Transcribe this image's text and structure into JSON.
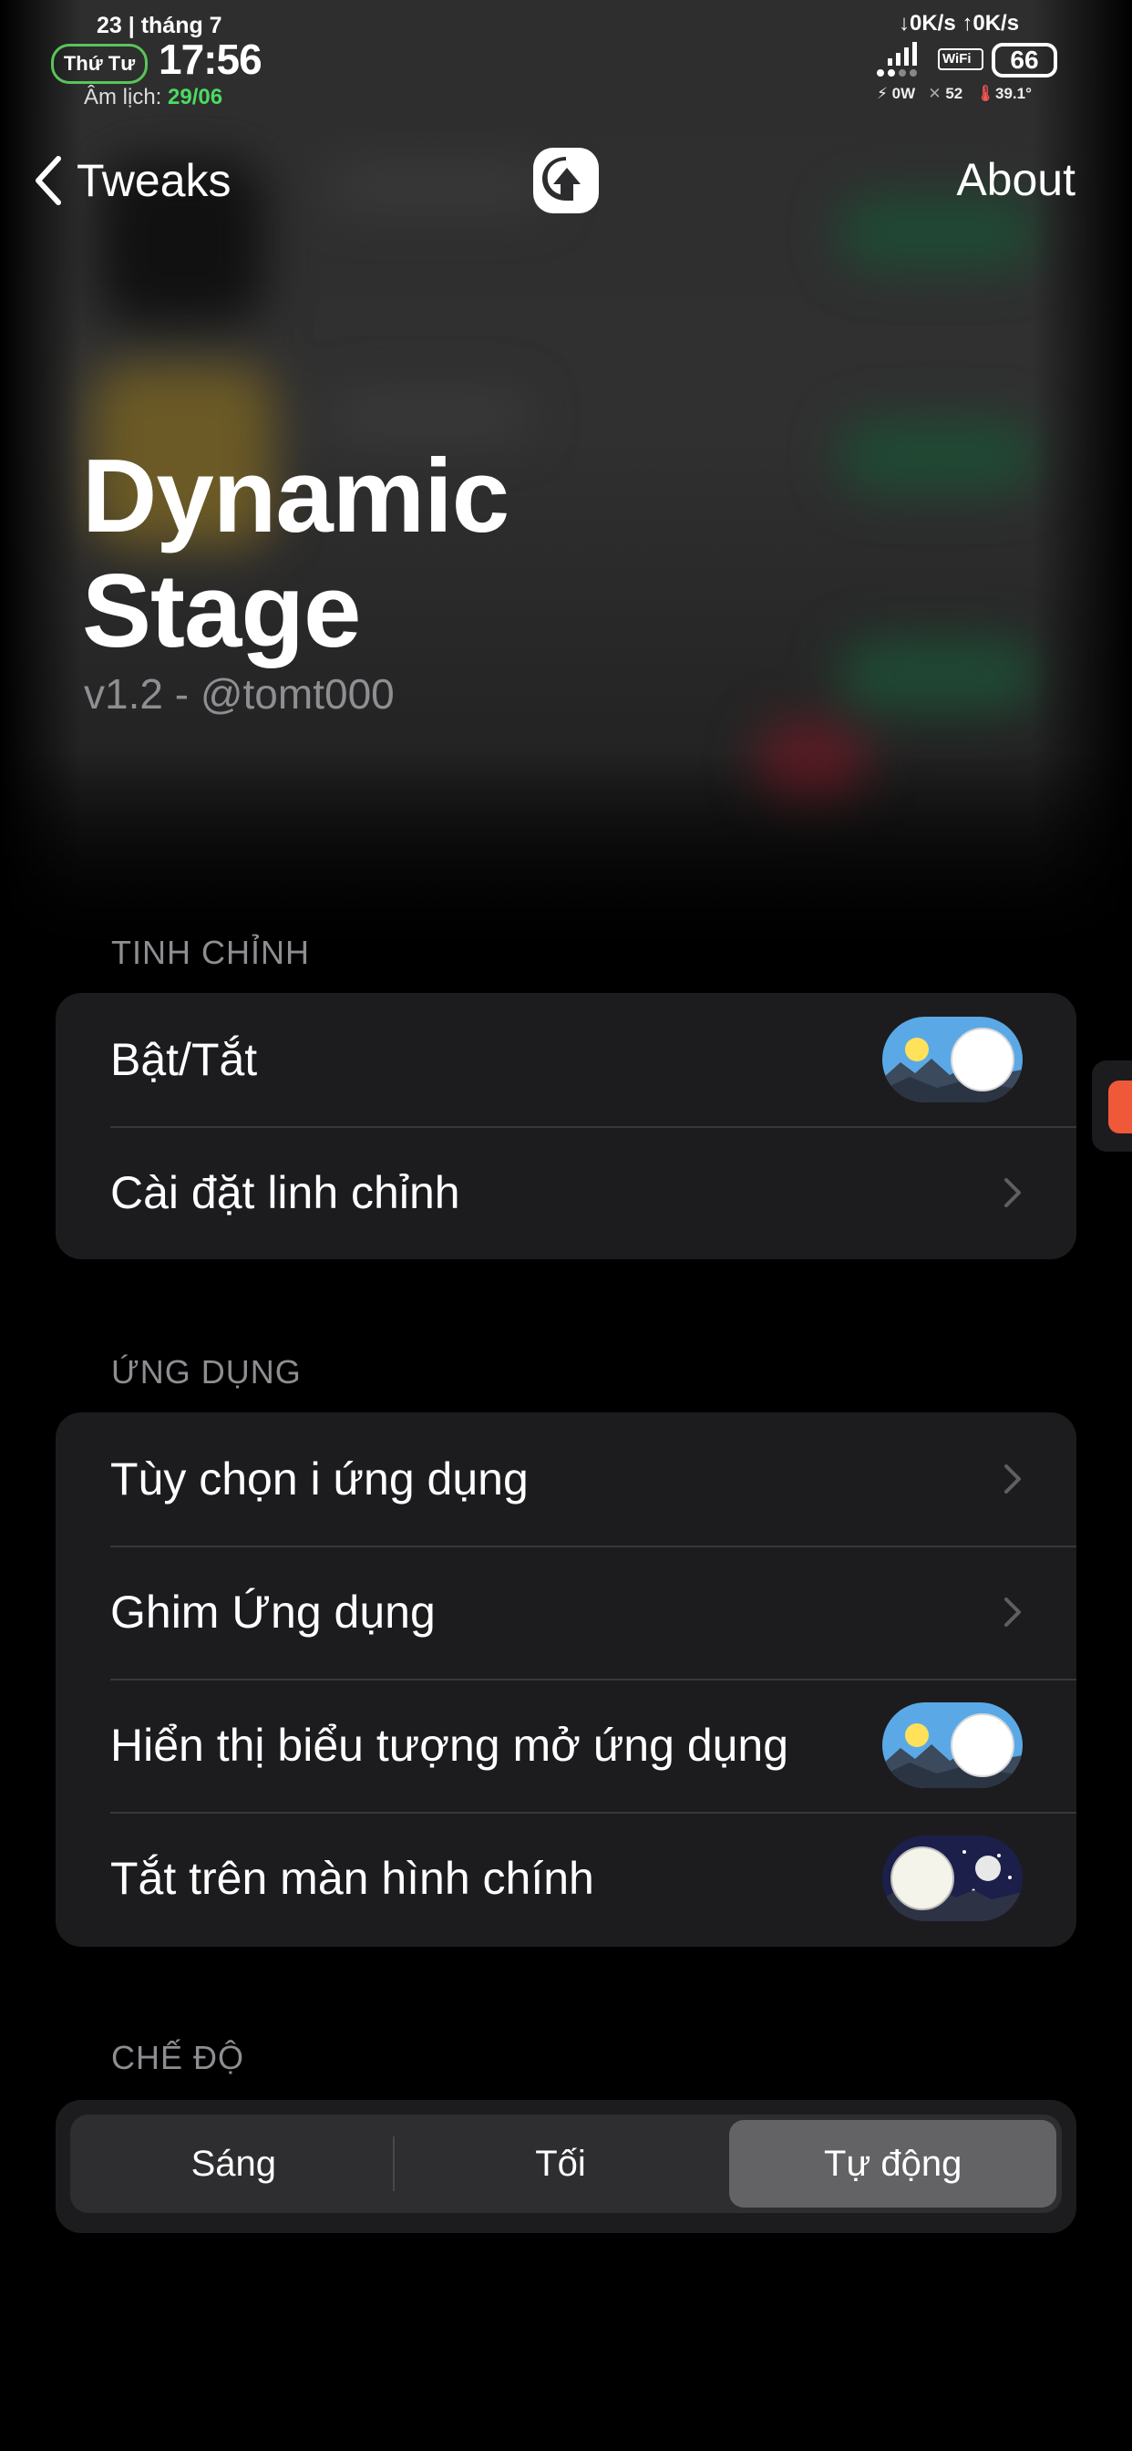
{
  "status_bar": {
    "date": "23 | tháng 7",
    "weekday": "Thứ Tư",
    "time": "17:56",
    "lunar_label": "Âm lịch:",
    "lunar_date": "29/06",
    "network_speed": "↓0K/s ↑0K/s",
    "wifi_label": "WiFi",
    "battery_percent": "66",
    "power": "⚡ 0W",
    "brightness": "52",
    "temperature": "39.1°"
  },
  "nav": {
    "back_label": "Tweaks",
    "about_label": "About"
  },
  "header": {
    "title_line1": "Dynamic",
    "title_line2": "Stage",
    "subtitle": "v1.2 - @tomt000"
  },
  "sections": {
    "tweak": {
      "label": "TINH CHỈNH",
      "enable_label": "Bật/Tắt",
      "enable_state": "on",
      "settings_label": "Cài đặt linh chỉnh"
    },
    "apps": {
      "label": "ỨNG DỤNG",
      "app_options_label": "Tùy chọn i ứng dụng",
      "pin_apps_label": "Ghim Ứng dụng",
      "show_open_icon_label": "Hiển thị biểu tượng mở ứng dụng",
      "show_open_icon_state": "on",
      "disable_homescreen_label": "Tắt trên màn hình chính",
      "disable_homescreen_state": "off"
    },
    "mode": {
      "label": "CHẾ ĐỘ",
      "options": [
        "Sáng",
        "Tối",
        "Tự động"
      ],
      "selected": "Tự động"
    }
  },
  "colors": {
    "accent_green": "#4cd964",
    "group_background": "#1c1c1e",
    "segment_selected": "#636366"
  },
  "icons": [
    "chevron-left-icon",
    "app-logo-icon",
    "chevron-right-icon",
    "day-night-toggle-icon"
  ]
}
